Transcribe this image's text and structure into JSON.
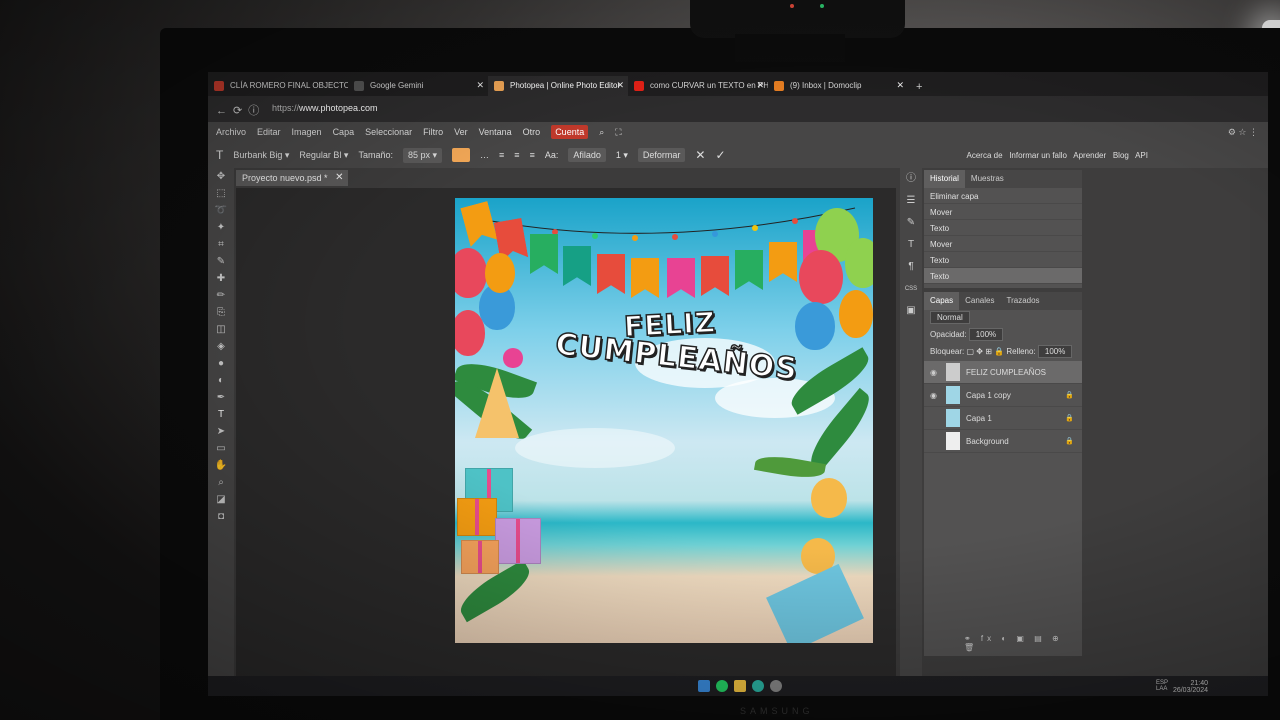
{
  "browser": {
    "tabs": [
      {
        "label": "CLÍA ROMERO FINAL OBJECTO",
        "active": false
      },
      {
        "label": "Google Gemini",
        "active": false
      },
      {
        "label": "Photopea | Online Photo Editor",
        "active": true
      },
      {
        "label": "como CURVAR un TEXTO en PHO",
        "active": false
      },
      {
        "label": "(9) Inbox | Domoclip",
        "active": false
      }
    ],
    "url_prefix": "https://",
    "url_domain": "www.photopea.com"
  },
  "menu": {
    "items": [
      "Archivo",
      "Editar",
      "Imagen",
      "Capa",
      "Seleccionar",
      "Filtro",
      "Ver",
      "Ventana",
      "Otro"
    ],
    "account": "Cuenta"
  },
  "options": {
    "font": "Burbank Big ▾",
    "style": "Regular Bl ▾",
    "size_label": "Tamaño:",
    "size_value": "85 px ▾",
    "aa_label": "Aa:",
    "aa_value": "Afilado",
    "spacing_value": "1 ▾",
    "warp_button": "Deformar",
    "color": "#f3a857",
    "links": [
      "Acerca de",
      "Informar un fallo",
      "Aprender",
      "Blog",
      "API"
    ]
  },
  "document": {
    "tab": "Proyecto nuevo.psd *",
    "title_line1": "FELIZ",
    "title_line2": "CUMPLEAÑOS"
  },
  "history": {
    "tabs": [
      "Historial",
      "Muestras"
    ],
    "items": [
      "Eliminar capa",
      "Mover",
      "Texto",
      "Mover",
      "Texto",
      "Texto"
    ],
    "selected_index": 5
  },
  "layers": {
    "tabs": [
      "Capas",
      "Canales",
      "Trazados"
    ],
    "blend_mode": "Normal",
    "opacity_label": "Opacidad:",
    "opacity_value": "100%",
    "lock_label": "Bloquear:",
    "fill_label": "Relleno:",
    "fill_value": "100%",
    "items": [
      {
        "name": "FELIZ CUMPLEAÑOS",
        "selected": true
      },
      {
        "name": "Capa 1 copy",
        "selected": false
      },
      {
        "name": "Capa 1",
        "selected": false
      },
      {
        "name": "Background",
        "selected": false
      }
    ]
  },
  "taskbar": {
    "lang_line1": "ESP",
    "lang_line2": "LAA",
    "time": "21:40",
    "date": "26/03/2024"
  },
  "monitor_brand": "SAMSUNG"
}
